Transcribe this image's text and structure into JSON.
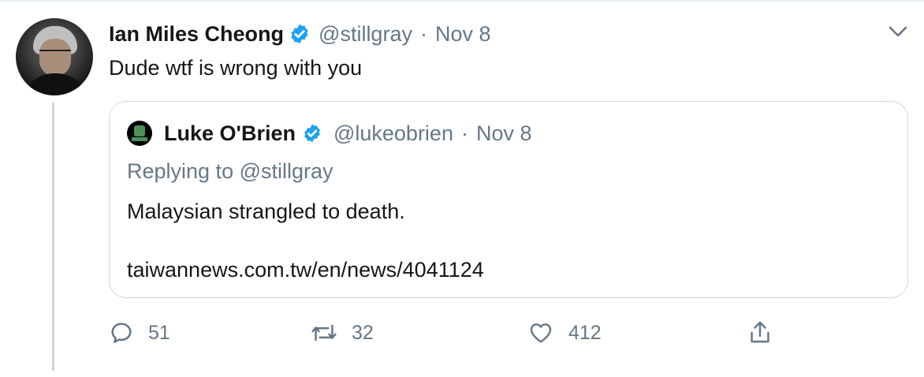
{
  "tweet": {
    "author_name": "Ian Miles Cheong",
    "author_handle": "@stillgray",
    "separator": "·",
    "date": "Nov 8",
    "text": "Dude wtf is wrong with you",
    "avatar_icon": "profile-photo",
    "verified_icon": "verified-badge-icon",
    "menu_icon": "chevron-down-icon"
  },
  "quoted_tweet": {
    "author_name": "Luke O'Brien",
    "author_handle": "@lukeobrien",
    "separator": "·",
    "date": "Nov 8",
    "replying_prefix": "Replying to",
    "replying_to": "@stillgray",
    "text": "Malaysian strangled to death.",
    "link": "taiwannews.com.tw/en/news/4041124",
    "avatar_icon": "union-fist-avatar"
  },
  "actions": {
    "reply_count": "51",
    "retweet_count": "32",
    "like_count": "412"
  },
  "colors": {
    "text_primary": "#14171a",
    "text_secondary": "#657786",
    "verified_blue": "#1da1f2",
    "border": "#ccd6dd"
  }
}
